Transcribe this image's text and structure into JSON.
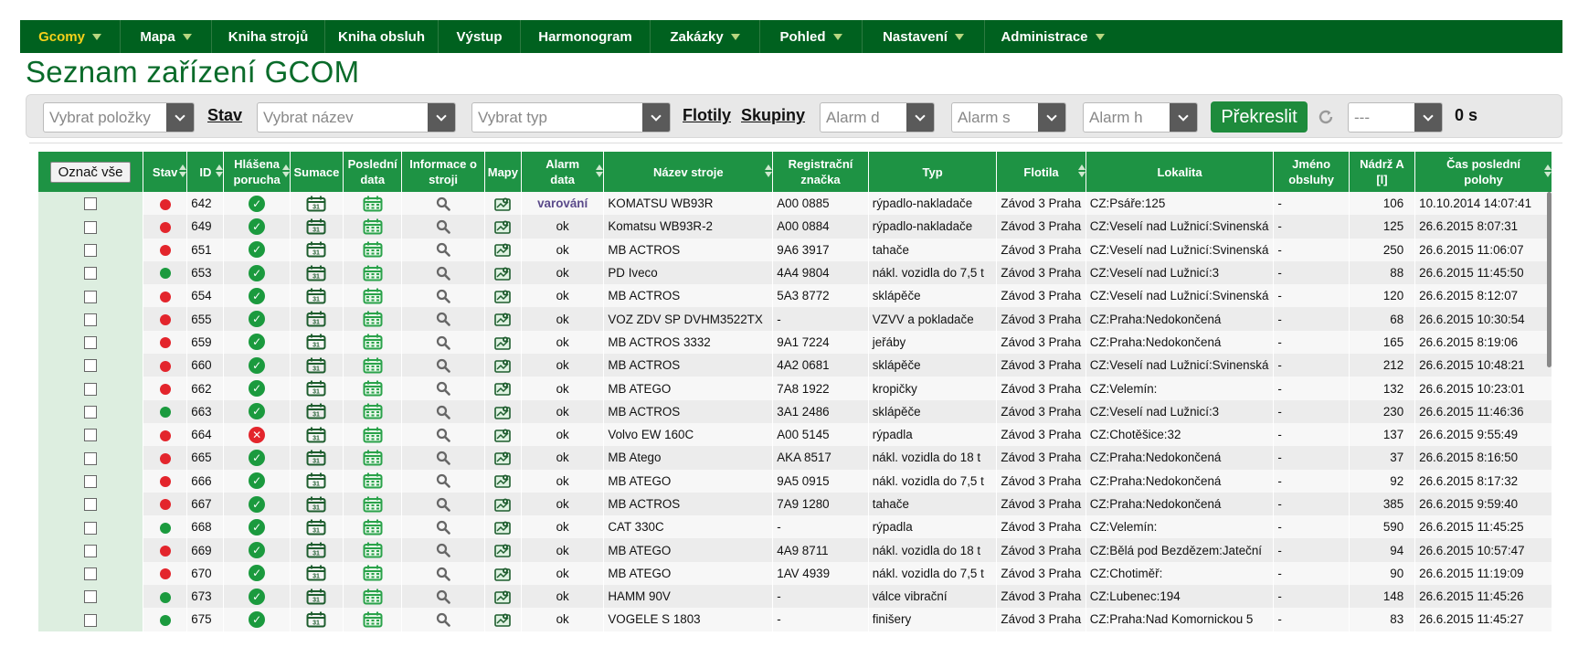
{
  "nav": [
    {
      "label": "Gcomy",
      "dropdown": true,
      "active": true
    },
    {
      "label": "Mapa",
      "dropdown": true
    },
    {
      "label": "Kniha strojů",
      "dropdown": false
    },
    {
      "label": "Kniha obsluh",
      "dropdown": false
    },
    {
      "label": "Výstup",
      "dropdown": false
    },
    {
      "label": "Harmonogram",
      "dropdown": false
    },
    {
      "label": "Zakázky",
      "dropdown": true
    },
    {
      "label": "Pohled",
      "dropdown": true
    },
    {
      "label": "Nastavení",
      "dropdown": true
    },
    {
      "label": "Administrace",
      "dropdown": true
    }
  ],
  "page_title": "Seznam zařízení GCOM",
  "toolbar": {
    "items_placeholder": "Vybrat položky",
    "stav_link": "Stav",
    "name_placeholder": "Vybrat název",
    "type_placeholder": "Vybrat typ",
    "fleets_link": "Flotily",
    "groups_link": "Skupiny",
    "alarm_d_placeholder": "Alarm d",
    "alarm_s_placeholder": "Alarm s",
    "alarm_h_placeholder": "Alarm h",
    "redraw_button": "Překreslit",
    "interval_value": "---",
    "seconds_label": "0 s"
  },
  "table": {
    "mark_all": "Označ vše",
    "headers": {
      "stav": "Stav",
      "id": "ID",
      "fault_1": "Hlášena",
      "fault_2": "porucha",
      "sums": "Sumace",
      "last_1": "Poslední",
      "last_2": "data",
      "info_1": "Informace o",
      "info_2": "stroji",
      "maps": "Mapy",
      "alarm_1": "Alarm",
      "alarm_2": "data",
      "name": "Název stroje",
      "reg_1": "Registrační",
      "reg_2": "značka",
      "type": "Typ",
      "fleet": "Flotila",
      "location": "Lokalita",
      "operator_1": "Jméno",
      "operator_2": "obsluhy",
      "tank_1": "Nádrž A",
      "tank_2": "[l]",
      "time_1": "Čas poslední",
      "time_2": "polohy"
    },
    "colors": {
      "red": "#e3252c",
      "green": "#1b9a3e"
    },
    "rows": [
      {
        "stav": "red",
        "id": "642",
        "fault": "ok",
        "alarm": "varování",
        "name": "KOMATSU WB93R",
        "reg": "A00 0885",
        "type": "rýpadlo-nakladače",
        "fleet": "Závod 3 Praha",
        "location": "CZ:Psáře:125",
        "operator": "-",
        "tank": "106",
        "time": "10.10.2014 14:07:41"
      },
      {
        "stav": "red",
        "id": "649",
        "fault": "ok",
        "alarm": "ok",
        "name": "Komatsu WB93R-2",
        "reg": "A00 0884",
        "type": "rýpadlo-nakladače",
        "fleet": "Závod 3 Praha",
        "location": "CZ:Veselí nad Lužnicí:Svinenská",
        "operator": "-",
        "tank": "125",
        "time": "26.6.2015 8:07:31"
      },
      {
        "stav": "red",
        "id": "651",
        "fault": "ok",
        "alarm": "ok",
        "name": "MB ACTROS",
        "reg": "9A6 3917",
        "type": "tahače",
        "fleet": "Závod 3 Praha",
        "location": "CZ:Veselí nad Lužnicí:Svinenská",
        "operator": "-",
        "tank": "250",
        "time": "26.6.2015 11:06:07"
      },
      {
        "stav": "green",
        "id": "653",
        "fault": "ok",
        "alarm": "ok",
        "name": "PD Iveco",
        "reg": "4A4 9804",
        "type": "nákl. vozidla do 7,5 t",
        "fleet": "Závod 3 Praha",
        "location": "CZ:Veselí nad Lužnicí:3",
        "operator": "-",
        "tank": "88",
        "time": "26.6.2015 11:45:50"
      },
      {
        "stav": "red",
        "id": "654",
        "fault": "ok",
        "alarm": "ok",
        "name": "MB ACTROS",
        "reg": "5A3 8772",
        "type": "sklápěče",
        "fleet": "Závod 3 Praha",
        "location": "CZ:Veselí nad Lužnicí:Svinenská",
        "operator": "-",
        "tank": "120",
        "time": "26.6.2015 8:12:07"
      },
      {
        "stav": "red",
        "id": "655",
        "fault": "ok",
        "alarm": "ok",
        "name": "VOZ ZDV SP DVHM3522TX",
        "reg": "-",
        "type": "VZVV a pokladače",
        "fleet": "Závod 3 Praha",
        "location": "CZ:Praha:Nedokončená",
        "operator": "-",
        "tank": "68",
        "time": "26.6.2015 10:30:54"
      },
      {
        "stav": "red",
        "id": "659",
        "fault": "ok",
        "alarm": "ok",
        "name": "MB ACTROS 3332",
        "reg": "9A1 7224",
        "type": "jeřáby",
        "fleet": "Závod 3 Praha",
        "location": "CZ:Praha:Nedokončená",
        "operator": "-",
        "tank": "165",
        "time": "26.6.2015 8:19:06"
      },
      {
        "stav": "red",
        "id": "660",
        "fault": "ok",
        "alarm": "ok",
        "name": "MB ACTROS",
        "reg": "4A2 0681",
        "type": "sklápěče",
        "fleet": "Závod 3 Praha",
        "location": "CZ:Veselí nad Lužnicí:Svinenská",
        "operator": "-",
        "tank": "212",
        "time": "26.6.2015 10:48:21"
      },
      {
        "stav": "red",
        "id": "662",
        "fault": "ok",
        "alarm": "ok",
        "name": "MB ATEGO",
        "reg": "7A8 1922",
        "type": "kropičky",
        "fleet": "Závod 3 Praha",
        "location": "CZ:Velemín:",
        "operator": "-",
        "tank": "132",
        "time": "26.6.2015 10:23:01"
      },
      {
        "stav": "green",
        "id": "663",
        "fault": "ok",
        "alarm": "ok",
        "name": "MB ACTROS",
        "reg": "3A1 2486",
        "type": "sklápěče",
        "fleet": "Závod 3 Praha",
        "location": "CZ:Veselí nad Lužnicí:3",
        "operator": "-",
        "tank": "230",
        "time": "26.6.2015 11:46:36"
      },
      {
        "stav": "red",
        "id": "664",
        "fault": "error",
        "alarm": "ok",
        "name": "Volvo EW 160C",
        "reg": "A00 5145",
        "type": "rýpadla",
        "fleet": "Závod 3 Praha",
        "location": "CZ:Chotěšice:32",
        "operator": "-",
        "tank": "137",
        "time": "26.6.2015 9:55:49"
      },
      {
        "stav": "red",
        "id": "665",
        "fault": "ok",
        "alarm": "ok",
        "name": "MB Atego",
        "reg": "AKA 8517",
        "type": "nákl. vozidla do 18 t",
        "fleet": "Závod 3 Praha",
        "location": "CZ:Praha:Nedokončená",
        "operator": "-",
        "tank": "37",
        "time": "26.6.2015 8:16:50"
      },
      {
        "stav": "red",
        "id": "666",
        "fault": "ok",
        "alarm": "ok",
        "name": "MB ATEGO",
        "reg": "9A5 0915",
        "type": "nákl. vozidla do 7,5 t",
        "fleet": "Závod 3 Praha",
        "location": "CZ:Praha:Nedokončená",
        "operator": "-",
        "tank": "92",
        "time": "26.6.2015 8:17:32"
      },
      {
        "stav": "red",
        "id": "667",
        "fault": "ok",
        "alarm": "ok",
        "name": "MB ACTROS",
        "reg": "7A9 1280",
        "type": "tahače",
        "fleet": "Závod 3 Praha",
        "location": "CZ:Praha:Nedokončená",
        "operator": "-",
        "tank": "385",
        "time": "26.6.2015 9:59:40"
      },
      {
        "stav": "green",
        "id": "668",
        "fault": "ok",
        "alarm": "ok",
        "name": "CAT 330C",
        "reg": "-",
        "type": "rýpadla",
        "fleet": "Závod 3 Praha",
        "location": "CZ:Velemín:",
        "operator": "-",
        "tank": "590",
        "time": "26.6.2015 11:45:25"
      },
      {
        "stav": "red",
        "id": "669",
        "fault": "ok",
        "alarm": "ok",
        "name": "MB ATEGO",
        "reg": "4A9 8711",
        "type": "nákl. vozidla do 18 t",
        "fleet": "Závod 3 Praha",
        "location": "CZ:Bělá pod Bezdězem:Jateční",
        "operator": "-",
        "tank": "94",
        "time": "26.6.2015 10:57:47"
      },
      {
        "stav": "red",
        "id": "670",
        "fault": "ok",
        "alarm": "ok",
        "name": "MB ATEGO",
        "reg": "1AV 4939",
        "type": "nákl. vozidla do 7,5 t",
        "fleet": "Závod 3 Praha",
        "location": "CZ:Chotiměř:",
        "operator": "-",
        "tank": "90",
        "time": "26.6.2015 11:19:09"
      },
      {
        "stav": "green",
        "id": "673",
        "fault": "ok",
        "alarm": "ok",
        "name": "HAMM 90V",
        "reg": "-",
        "type": "válce vibrační",
        "fleet": "Závod 3 Praha",
        "location": "CZ:Lubenec:194",
        "operator": "-",
        "tank": "148",
        "time": "26.6.2015 11:45:26"
      },
      {
        "stav": "green",
        "id": "675",
        "fault": "ok",
        "alarm": "ok",
        "name": "VOGELE S 1803",
        "reg": "-",
        "type": "finišery",
        "fleet": "Závod 3 Praha",
        "location": "CZ:Praha:Nad Komornickou 5",
        "operator": "-",
        "tank": "83",
        "time": "26.6.2015 11:45:27"
      }
    ]
  }
}
